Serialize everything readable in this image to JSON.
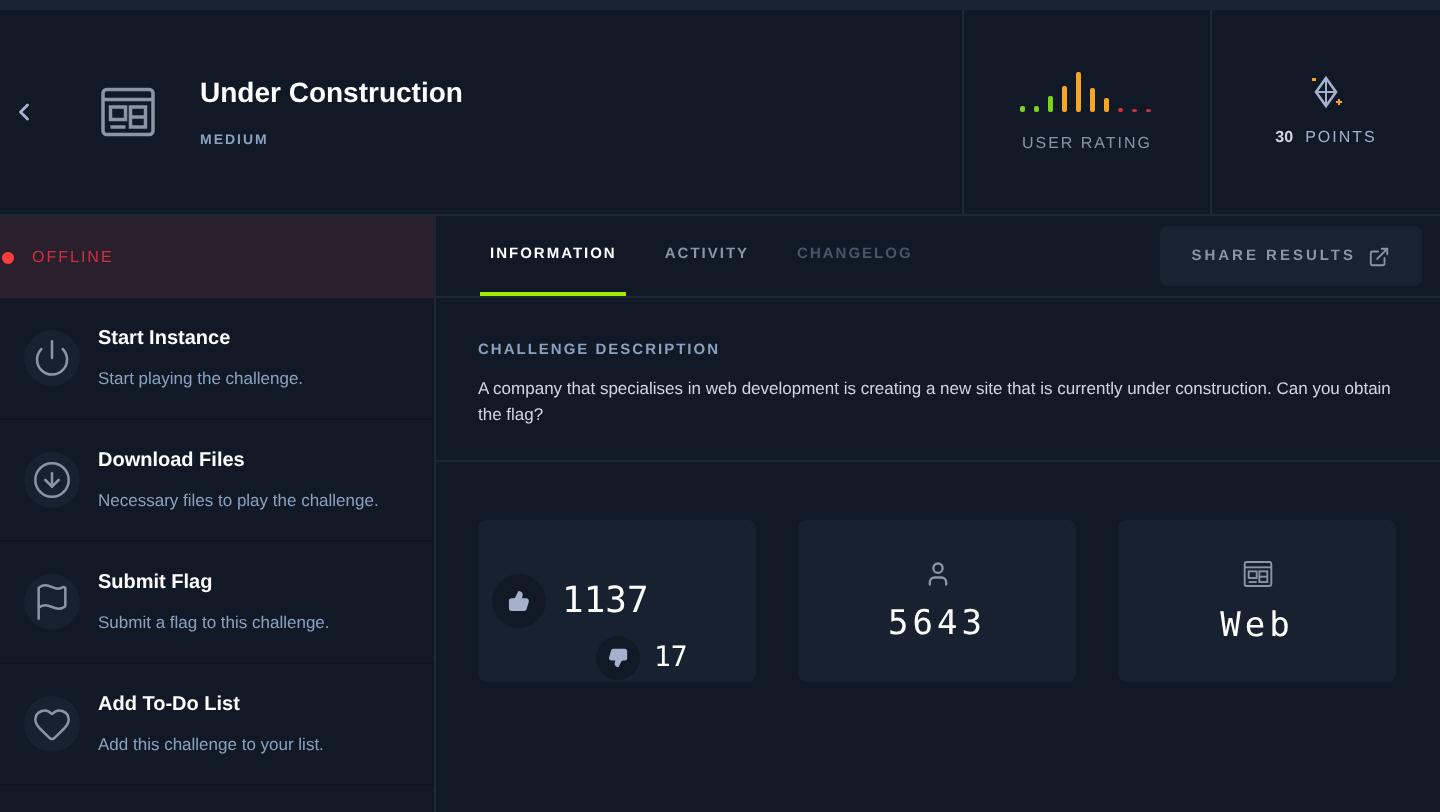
{
  "header": {
    "title": "Under Construction",
    "difficulty": "MEDIUM",
    "rating_label": "USER RATING",
    "points_value": "30",
    "points_label": "POINTS"
  },
  "status": {
    "label": "OFFLINE",
    "online": false
  },
  "actions": [
    {
      "kind": "power",
      "title": "Start Instance",
      "subtitle": "Start playing the challenge."
    },
    {
      "kind": "download",
      "title": "Download Files",
      "subtitle": "Necessary files to play the challenge."
    },
    {
      "kind": "flag",
      "title": "Submit Flag",
      "subtitle": "Submit a flag to this challenge."
    },
    {
      "kind": "heart",
      "title": "Add To-Do List",
      "subtitle": "Add this challenge to your list."
    }
  ],
  "tabs": [
    {
      "label": "INFORMATION",
      "selected": true,
      "disabled": false
    },
    {
      "label": "ACTIVITY",
      "selected": false,
      "disabled": false
    },
    {
      "label": "CHANGELOG",
      "selected": false,
      "disabled": true
    }
  ],
  "share_button": "SHARE RESULTS",
  "description": {
    "heading": "CHALLENGE DESCRIPTION",
    "text": "A company that specialises in web development is creating a new site that is currently under construction. Can you obtain the flag?"
  },
  "stats": [
    {
      "kind": "votes",
      "likes": "1137",
      "dislikes": "17"
    },
    {
      "kind": "users",
      "value": "5643"
    },
    {
      "kind": "category",
      "value": "Web"
    }
  ]
}
